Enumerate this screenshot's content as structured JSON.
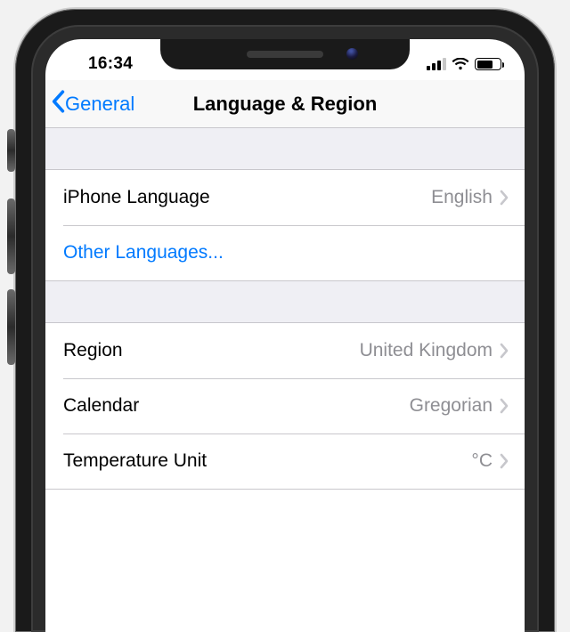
{
  "status": {
    "time": "16:34"
  },
  "nav": {
    "back_label": "General",
    "title": "Language & Region"
  },
  "group1": {
    "row0": {
      "label": "iPhone Language",
      "value": "English"
    },
    "row1": {
      "label": "Other Languages..."
    }
  },
  "group2": {
    "row0": {
      "label": "Region",
      "value": "United Kingdom"
    },
    "row1": {
      "label": "Calendar",
      "value": "Gregorian"
    },
    "row2": {
      "label": "Temperature Unit",
      "value": "°C"
    }
  }
}
